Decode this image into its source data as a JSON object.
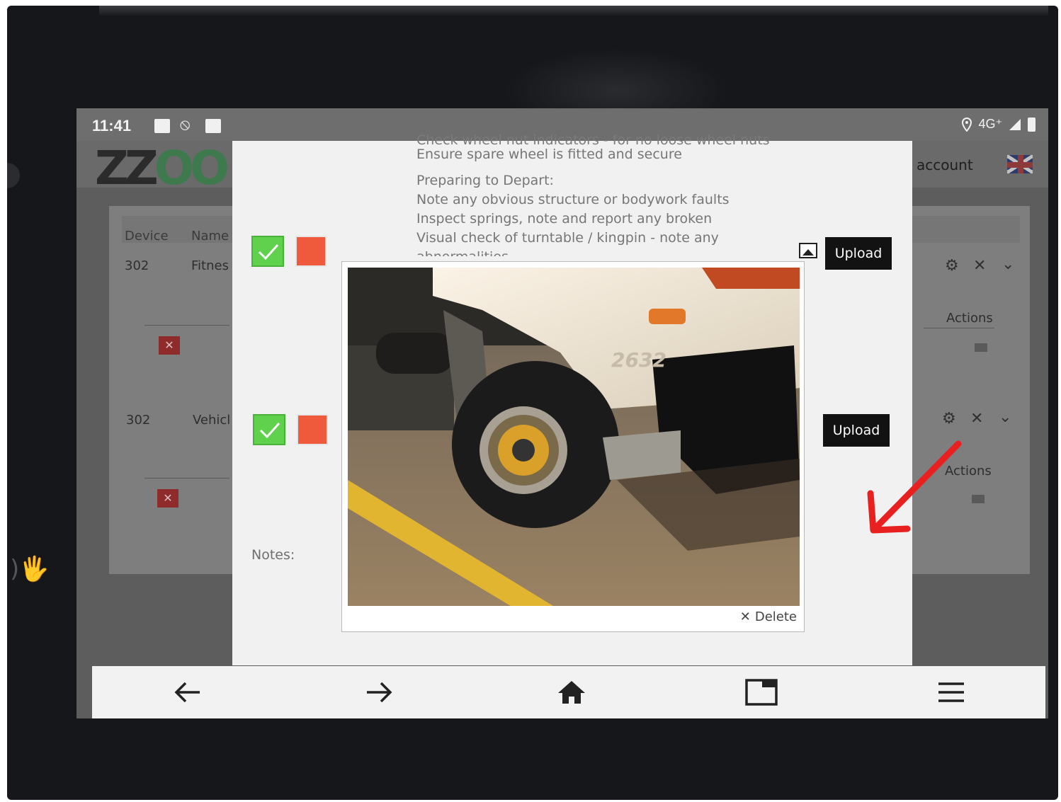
{
  "status_bar": {
    "time": "11:41",
    "network": "4G⁺"
  },
  "app": {
    "logo_text": [
      "ZZ",
      "OO"
    ],
    "account_label": "account",
    "table": {
      "headers": [
        "Device",
        "Name",
        "Actions"
      ],
      "rows": [
        {
          "device": "302",
          "name": "Fitnes",
          "actions_label": "Actions"
        },
        {
          "device": "302",
          "name": "Vehicl",
          "actions_label": "Actions"
        }
      ],
      "delete_glyph": "✕"
    }
  },
  "modal": {
    "instructions": {
      "cut_line": "Check wheel nut indicators - for no loose wheel nuts",
      "line1": "Ensure spare wheel is fitted and secure",
      "section_title": "Preparing to Depart:",
      "lines": [
        "Note any obvious structure or bodywork faults",
        "Inspect springs, note and report any broken",
        "Visual check of turntable / kingpin - note any",
        "abnormalities"
      ]
    },
    "upload_label": "Upload",
    "notes_label": "Notes:",
    "delete_label": "Delete",
    "photo_number": "2632"
  },
  "colors": {
    "pass_green": "#5fd14d",
    "fail_red": "#f05a3c",
    "annotation_red": "#e82020",
    "button_dark": "#121212"
  },
  "icons": [
    "back-arrow-icon",
    "forward-arrow-icon",
    "home-icon",
    "tabs-icon",
    "menu-icon",
    "image-icon",
    "close-icon",
    "gear-icon",
    "chevron-down-icon"
  ]
}
